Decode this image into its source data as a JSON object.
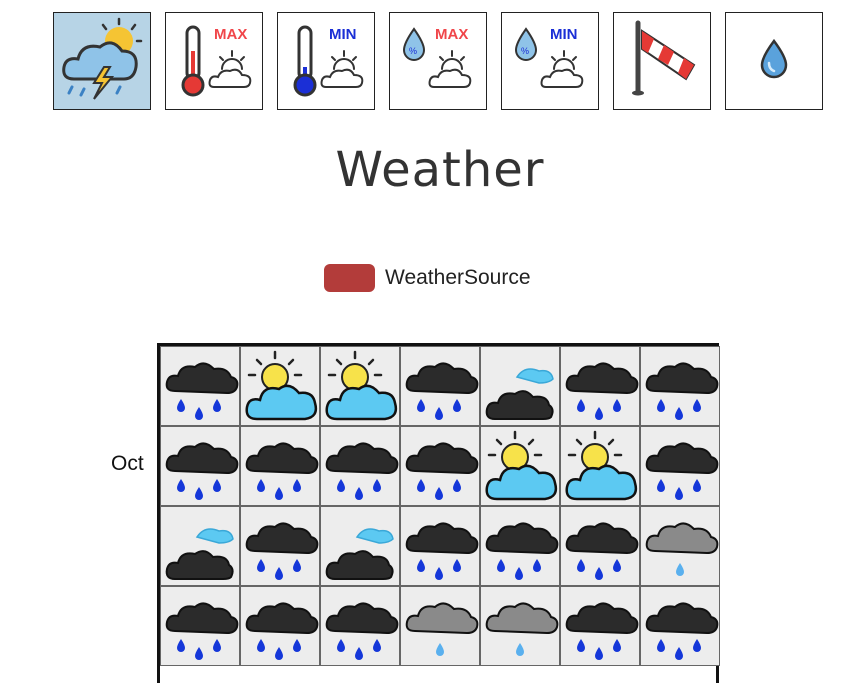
{
  "toolbar": {
    "buttons": [
      {
        "icon": "weather-storm-icon",
        "active": true
      },
      {
        "icon": "max-temperature-icon",
        "badge": "MAX",
        "badge_color": "#f0464a"
      },
      {
        "icon": "min-temperature-icon",
        "badge": "MIN",
        "badge_color": "#1b2fd6"
      },
      {
        "icon": "max-humidity-icon",
        "badge": "MAX",
        "badge_color": "#f0464a"
      },
      {
        "icon": "min-humidity-icon",
        "badge": "MIN",
        "badge_color": "#1b2fd6"
      },
      {
        "icon": "windsock-icon"
      },
      {
        "icon": "precipitation-drop-icon"
      }
    ]
  },
  "title": "Weather",
  "legend": {
    "label": "WeatherSource",
    "color": "#b33c3a"
  },
  "calendar": {
    "month_label": "Oct",
    "rows": [
      [
        "rain",
        "partly-sunny",
        "partly-sunny",
        "rain",
        "cloudy",
        "rain",
        "rain"
      ],
      [
        "rain",
        "rain",
        "rain",
        "rain",
        "partly-sunny",
        "partly-sunny",
        "rain"
      ],
      [
        "cloudy",
        "rain",
        "cloudy",
        "rain",
        "rain",
        "rain",
        "light-rain"
      ],
      [
        "rain",
        "rain",
        "rain",
        "light-rain",
        "light-rain",
        "rain",
        "rain"
      ]
    ]
  }
}
